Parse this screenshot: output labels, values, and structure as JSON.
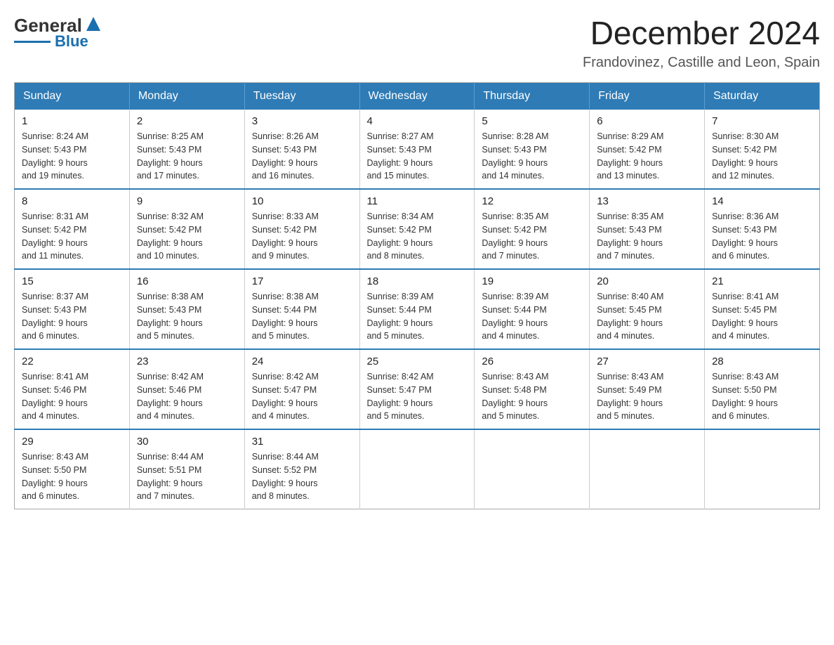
{
  "header": {
    "month_title": "December 2024",
    "location": "Frandovinez, Castille and Leon, Spain",
    "logo_general": "General",
    "logo_blue": "Blue"
  },
  "days_of_week": [
    "Sunday",
    "Monday",
    "Tuesday",
    "Wednesday",
    "Thursday",
    "Friday",
    "Saturday"
  ],
  "weeks": [
    [
      {
        "day": "1",
        "sunrise": "8:24 AM",
        "sunset": "5:43 PM",
        "daylight": "9 hours and 19 minutes."
      },
      {
        "day": "2",
        "sunrise": "8:25 AM",
        "sunset": "5:43 PM",
        "daylight": "9 hours and 17 minutes."
      },
      {
        "day": "3",
        "sunrise": "8:26 AM",
        "sunset": "5:43 PM",
        "daylight": "9 hours and 16 minutes."
      },
      {
        "day": "4",
        "sunrise": "8:27 AM",
        "sunset": "5:43 PM",
        "daylight": "9 hours and 15 minutes."
      },
      {
        "day": "5",
        "sunrise": "8:28 AM",
        "sunset": "5:43 PM",
        "daylight": "9 hours and 14 minutes."
      },
      {
        "day": "6",
        "sunrise": "8:29 AM",
        "sunset": "5:42 PM",
        "daylight": "9 hours and 13 minutes."
      },
      {
        "day": "7",
        "sunrise": "8:30 AM",
        "sunset": "5:42 PM",
        "daylight": "9 hours and 12 minutes."
      }
    ],
    [
      {
        "day": "8",
        "sunrise": "8:31 AM",
        "sunset": "5:42 PM",
        "daylight": "9 hours and 11 minutes."
      },
      {
        "day": "9",
        "sunrise": "8:32 AM",
        "sunset": "5:42 PM",
        "daylight": "9 hours and 10 minutes."
      },
      {
        "day": "10",
        "sunrise": "8:33 AM",
        "sunset": "5:42 PM",
        "daylight": "9 hours and 9 minutes."
      },
      {
        "day": "11",
        "sunrise": "8:34 AM",
        "sunset": "5:42 PM",
        "daylight": "9 hours and 8 minutes."
      },
      {
        "day": "12",
        "sunrise": "8:35 AM",
        "sunset": "5:42 PM",
        "daylight": "9 hours and 7 minutes."
      },
      {
        "day": "13",
        "sunrise": "8:35 AM",
        "sunset": "5:43 PM",
        "daylight": "9 hours and 7 minutes."
      },
      {
        "day": "14",
        "sunrise": "8:36 AM",
        "sunset": "5:43 PM",
        "daylight": "9 hours and 6 minutes."
      }
    ],
    [
      {
        "day": "15",
        "sunrise": "8:37 AM",
        "sunset": "5:43 PM",
        "daylight": "9 hours and 6 minutes."
      },
      {
        "day": "16",
        "sunrise": "8:38 AM",
        "sunset": "5:43 PM",
        "daylight": "9 hours and 5 minutes."
      },
      {
        "day": "17",
        "sunrise": "8:38 AM",
        "sunset": "5:44 PM",
        "daylight": "9 hours and 5 minutes."
      },
      {
        "day": "18",
        "sunrise": "8:39 AM",
        "sunset": "5:44 PM",
        "daylight": "9 hours and 5 minutes."
      },
      {
        "day": "19",
        "sunrise": "8:39 AM",
        "sunset": "5:44 PM",
        "daylight": "9 hours and 4 minutes."
      },
      {
        "day": "20",
        "sunrise": "8:40 AM",
        "sunset": "5:45 PM",
        "daylight": "9 hours and 4 minutes."
      },
      {
        "day": "21",
        "sunrise": "8:41 AM",
        "sunset": "5:45 PM",
        "daylight": "9 hours and 4 minutes."
      }
    ],
    [
      {
        "day": "22",
        "sunrise": "8:41 AM",
        "sunset": "5:46 PM",
        "daylight": "9 hours and 4 minutes."
      },
      {
        "day": "23",
        "sunrise": "8:42 AM",
        "sunset": "5:46 PM",
        "daylight": "9 hours and 4 minutes."
      },
      {
        "day": "24",
        "sunrise": "8:42 AM",
        "sunset": "5:47 PM",
        "daylight": "9 hours and 4 minutes."
      },
      {
        "day": "25",
        "sunrise": "8:42 AM",
        "sunset": "5:47 PM",
        "daylight": "9 hours and 5 minutes."
      },
      {
        "day": "26",
        "sunrise": "8:43 AM",
        "sunset": "5:48 PM",
        "daylight": "9 hours and 5 minutes."
      },
      {
        "day": "27",
        "sunrise": "8:43 AM",
        "sunset": "5:49 PM",
        "daylight": "9 hours and 5 minutes."
      },
      {
        "day": "28",
        "sunrise": "8:43 AM",
        "sunset": "5:50 PM",
        "daylight": "9 hours and 6 minutes."
      }
    ],
    [
      {
        "day": "29",
        "sunrise": "8:43 AM",
        "sunset": "5:50 PM",
        "daylight": "9 hours and 6 minutes."
      },
      {
        "day": "30",
        "sunrise": "8:44 AM",
        "sunset": "5:51 PM",
        "daylight": "9 hours and 7 minutes."
      },
      {
        "day": "31",
        "sunrise": "8:44 AM",
        "sunset": "5:52 PM",
        "daylight": "9 hours and 8 minutes."
      },
      null,
      null,
      null,
      null
    ]
  ],
  "labels": {
    "sunrise": "Sunrise:",
    "sunset": "Sunset:",
    "daylight": "Daylight:"
  }
}
